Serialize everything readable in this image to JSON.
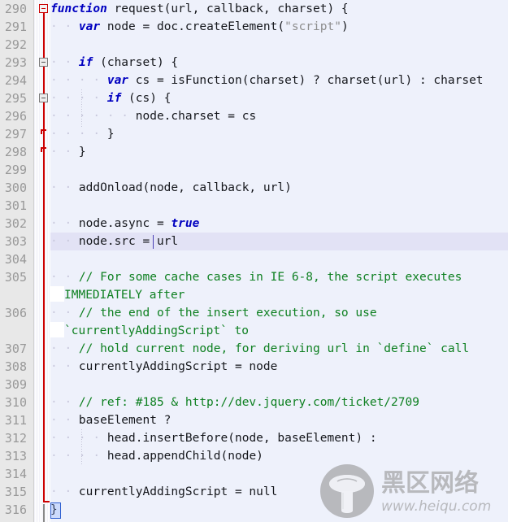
{
  "editor": {
    "language": "javascript",
    "current_line": 303,
    "first_line": 290,
    "last_line": 316,
    "colors": {
      "background": "#eef1fb",
      "gutter_background": "#e8e8e8",
      "line_number": "#999999",
      "current_line_highlight": "#e3e3f6",
      "keyword": "#0000c0",
      "comment": "#0e8021",
      "string": "#8e8e8e",
      "identifier": "#15171c",
      "fold_line": "#cc0000",
      "caret": "#4a3fb5"
    }
  },
  "lines": [
    {
      "num": "290",
      "text": "function request(url, callback, charset) {"
    },
    {
      "num": "291",
      "text": "    var node = doc.createElement(\"script\")"
    },
    {
      "num": "292",
      "text": ""
    },
    {
      "num": "293",
      "text": "    if (charset) {"
    },
    {
      "num": "294",
      "text": "        var cs = isFunction(charset) ? charset(url) : charset"
    },
    {
      "num": "295",
      "text": "        if (cs) {"
    },
    {
      "num": "296",
      "text": "            node.charset = cs"
    },
    {
      "num": "297",
      "text": "        }"
    },
    {
      "num": "298",
      "text": "    }"
    },
    {
      "num": "299",
      "text": ""
    },
    {
      "num": "300",
      "text": "    addOnload(node, callback, url)"
    },
    {
      "num": "301",
      "text": ""
    },
    {
      "num": "302",
      "text": "    node.async = true"
    },
    {
      "num": "303",
      "text": "    node.src = url"
    },
    {
      "num": "304",
      "text": ""
    },
    {
      "num": "305",
      "text": "    // For some cache cases in IE 6-8, the script executes IMMEDIATELY after"
    },
    {
      "num": "306",
      "text": "    // the end of the insert execution, so use `currentlyAddingScript` to"
    },
    {
      "num": "307",
      "text": "    // hold current node, for deriving url in `define` call"
    },
    {
      "num": "308",
      "text": "    currentlyAddingScript = node"
    },
    {
      "num": "309",
      "text": ""
    },
    {
      "num": "310",
      "text": "    // ref: #185 & http://dev.jquery.com/ticket/2709"
    },
    {
      "num": "311",
      "text": "    baseElement ?"
    },
    {
      "num": "312",
      "text": "        head.insertBefore(node, baseElement) :"
    },
    {
      "num": "313",
      "text": "        head.appendChild(node)"
    },
    {
      "num": "314",
      "text": ""
    },
    {
      "num": "315",
      "text": "    currentlyAddingScript = null"
    },
    {
      "num": "316",
      "text": "}"
    }
  ],
  "line_numbers": {
    "n290": "290",
    "n291": "291",
    "n292": "292",
    "n293": "293",
    "n294": "294",
    "n295": "295",
    "n296": "296",
    "n297": "297",
    "n298": "298",
    "n299": "299",
    "n300": "300",
    "n301": "301",
    "n302": "302",
    "n303": "303",
    "n304": "304",
    "n305": "305",
    "n306": "306",
    "n307": "307",
    "n308": "308",
    "n309": "309",
    "n310": "310",
    "n311": "311",
    "n312": "312",
    "n313": "313",
    "n314": "314",
    "n315": "315",
    "n316": "316"
  },
  "tokens": {
    "l290_kw": "function",
    "l290_rest": " request(url, callback, charset) {",
    "l291_kw": "var",
    "l291_a": " node = doc.createElement(",
    "l291_str": "\"script\"",
    "l291_b": ")",
    "l293_kw": "if",
    "l293_rest": " (charset) {",
    "l294_kw": "var",
    "l294_rest": " cs = isFunction(charset) ? charset(url) : charset",
    "l295_kw": "if",
    "l295_rest": " (cs) {",
    "l296_rest": "node.charset = cs",
    "l297_rest": "}",
    "l298_rest": "}",
    "l300_rest": "addOnload(node, callback, url)",
    "l302_a": "node.async = ",
    "l302_kw": "true",
    "l303_rest": "node.src = url",
    "l305_cmt": "// For some cache cases in IE 6-8, the script executes",
    "l305_wrap": "IMMEDIATELY after",
    "l306_cmt": "// the end of the insert execution, so use",
    "l306_wrap": "`currentlyAddingScript` to",
    "l307_cmt": "// hold current node, for deriving url in `define` call",
    "l308_rest": "currentlyAddingScript = node",
    "l310_cmt": "// ref: #185 & http://dev.jquery.com/ticket/2709",
    "l311_rest": "baseElement ?",
    "l312_rest": "head.insertBefore(node, baseElement) :",
    "l313_rest": "head.appendChild(node)",
    "l315_rest": "currentlyAddingScript = null",
    "l316_rest": "}"
  },
  "fold_markers": [
    {
      "line": "290",
      "state": "expanded",
      "color": "red"
    },
    {
      "line": "293",
      "state": "expanded",
      "color": "gray"
    },
    {
      "line": "295",
      "state": "expanded",
      "color": "gray"
    }
  ],
  "watermark": {
    "title": "黑区网络",
    "url": "www.heiqu.com",
    "logo": "mushroom-icon"
  }
}
